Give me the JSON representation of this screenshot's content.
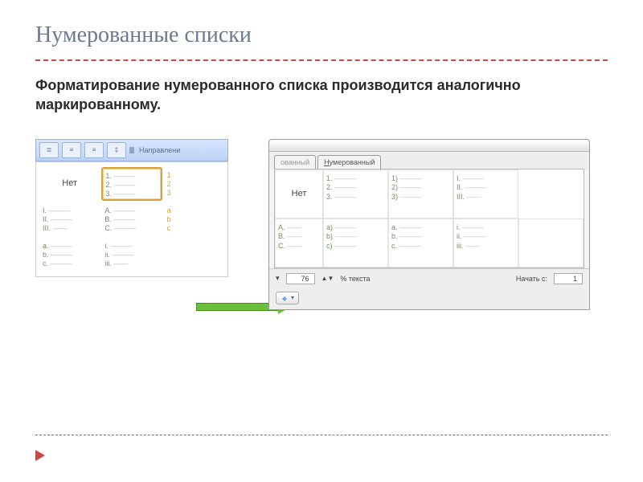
{
  "title": "Нумерованные списки",
  "body": "Форматирование нумерованного списка производится аналогично маркированному.",
  "panel1": {
    "ribbon_label": "Направлени",
    "none": "Нет",
    "opts": {
      "num": [
        "1.",
        "2.",
        "3."
      ],
      "num_cut": [
        "1",
        "2",
        "3"
      ],
      "roman_up": [
        "I.",
        "II.",
        "III."
      ],
      "alpha_up": [
        "A.",
        "B.",
        "C."
      ],
      "alpha_cut": [
        "a",
        "b",
        "c"
      ],
      "alpha_low": [
        "a.",
        "b.",
        "c."
      ],
      "roman_low": [
        "i.",
        "ii.",
        "iii."
      ]
    }
  },
  "panel2": {
    "tab_cut": "ованный",
    "tab_active": "Нумерованный",
    "tab_active_ul": "Н",
    "none": "Нет",
    "opts": {
      "num_dot": [
        "1.",
        "2.",
        "3."
      ],
      "num_paren": [
        "1)",
        "2)",
        "3)"
      ],
      "roman_up": [
        "I.",
        "II.",
        "III."
      ],
      "alpha_up_cut": [
        "A.",
        "B.",
        "C."
      ],
      "alpha_low_paren": [
        "a)",
        "b)",
        "c)"
      ],
      "alpha_low_dot": [
        "a.",
        "b.",
        "c."
      ],
      "roman_low_cut": [
        "i.",
        "ii.",
        "iii."
      ]
    },
    "size_value": "76",
    "size_label": "% текста",
    "start_label": "Начать с:",
    "start_value": "1"
  }
}
